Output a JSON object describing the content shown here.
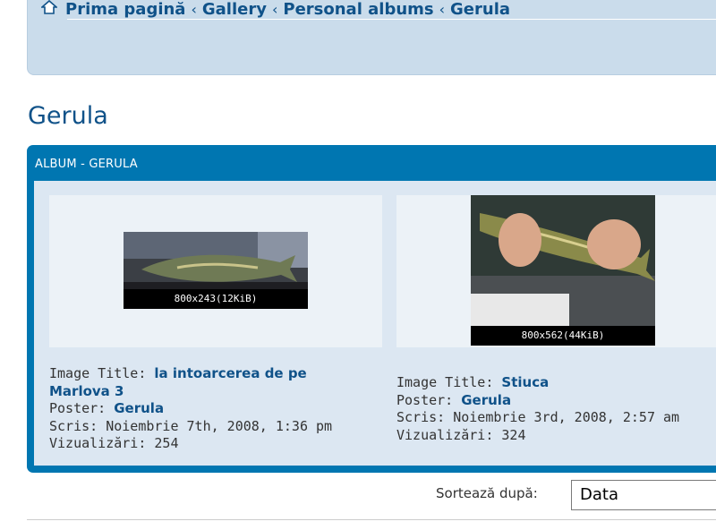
{
  "breadcrumb": {
    "items": [
      "Prima pagină",
      "Gallery",
      "Personal albums",
      "Gerula"
    ],
    "separator": "‹"
  },
  "page_title": "Gerula",
  "album": {
    "header": "ALBUM - GERULA",
    "images": [
      {
        "caption": "800x243(12KiB)",
        "title_label": "Image Title:",
        "title": "la intoarcerea de pe Marlova 3",
        "poster_label": "Poster:",
        "poster": "Gerula",
        "posted": "Scris: Noiembrie 7th, 2008, 1:36 pm",
        "views": "Vizualizări: 254"
      },
      {
        "caption": "800x562(44KiB)",
        "title_label": "Image Title:",
        "title": "Stiuca",
        "poster_label": "Poster:",
        "poster": "Gerula",
        "posted": "Scris: Noiembrie 3rd, 2008, 2:57 am",
        "views": "Vizualizări: 324"
      }
    ]
  },
  "sort": {
    "label": "Sortează după:",
    "value": "Data"
  },
  "colors": {
    "link": "#105289",
    "panel": "#0076b1",
    "nav_bg": "#cadceb"
  }
}
